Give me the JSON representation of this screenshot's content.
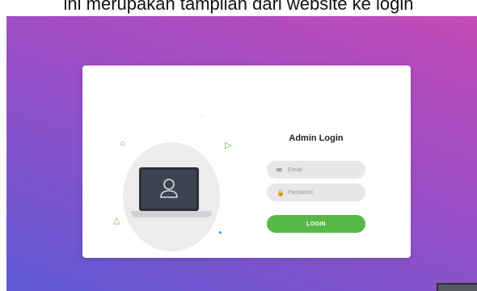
{
  "header_caption": "ini merupakan tampilan dari website ke login",
  "login": {
    "title": "Admin Login",
    "email_placeholder": "Email",
    "password_placeholder": "Password",
    "button_label": "LOGIN"
  },
  "icons": {
    "email": "envelope-icon",
    "password": "lock-icon",
    "user": "user-icon"
  },
  "colors": {
    "background_gradient": [
      "#c24bb8",
      "#9a4fc6",
      "#5f5bd6"
    ],
    "accent_button": "#57b846",
    "input_bg": "#e7e7e7",
    "card_bg": "#ffffff"
  }
}
